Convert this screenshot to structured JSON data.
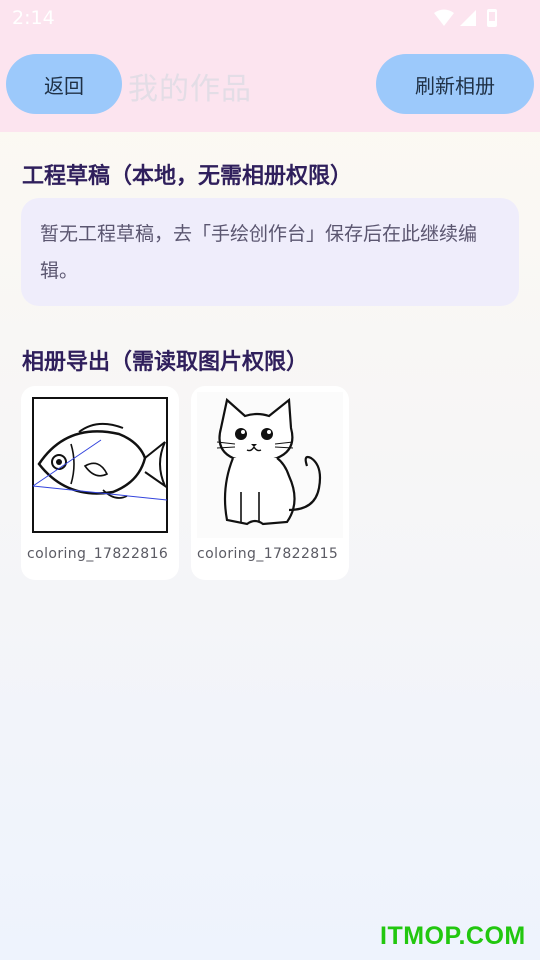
{
  "status_bar": {
    "time": "2:14",
    "icons": [
      "wifi-icon",
      "signal-icon",
      "battery-icon"
    ]
  },
  "app_bar": {
    "back_label": "返回",
    "title": "我的作品",
    "refresh_label": "刷新相册"
  },
  "drafts": {
    "title": "工程草稿（本地，无需相册权限）",
    "empty_line1": "暂无工程草稿，去「手绘创作台」保存后在此继续编",
    "empty_line2": "辑。"
  },
  "album": {
    "title": "相册导出（需读取图片权限）",
    "items": [
      {
        "name": "coloring_17822816",
        "image": "fish-drawing"
      },
      {
        "name": "coloring_17822815",
        "image": "cat-drawing"
      }
    ]
  },
  "watermark": "ITMOP.COM",
  "colors": {
    "header_bg": "#fce4ef",
    "button_bg": "#9cc9fb",
    "title_text": "#2f1f5c",
    "card_bg": "#efedfb",
    "watermark": "#22c70f"
  }
}
